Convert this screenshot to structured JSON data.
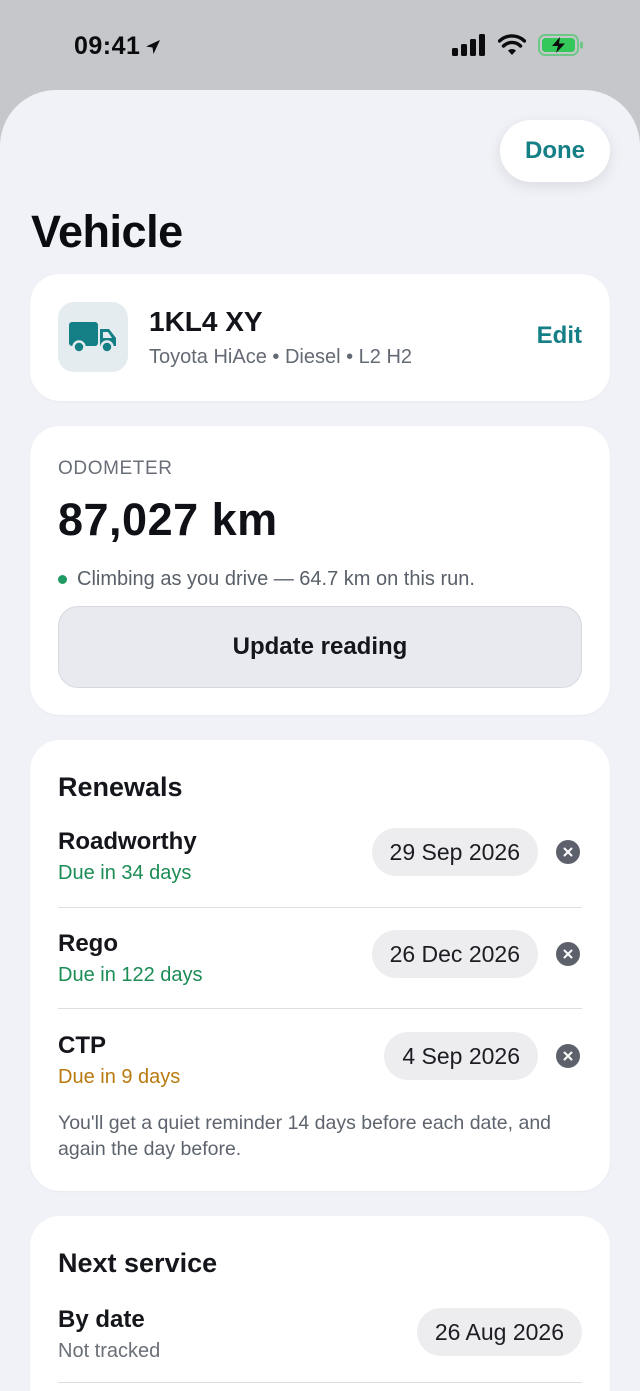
{
  "status_bar": {
    "time": "09:41",
    "icons": [
      "location-arrow-icon",
      "cellular-signal-icon",
      "wifi-icon",
      "battery-charging-icon"
    ],
    "battery_color": "#34c759"
  },
  "header": {
    "done_label": "Done",
    "title": "Vehicle"
  },
  "vehicle": {
    "icon": "truck-icon",
    "plate": "1KL4 XY",
    "description": "Toyota HiAce • Diesel • L2 H2",
    "edit_label": "Edit"
  },
  "odometer": {
    "label": "ODOMETER",
    "value": "87,027 km",
    "note": "Climbing as you drive — 64.7 km on this run.",
    "update_label": "Update reading"
  },
  "renewals": {
    "title": "Renewals",
    "items": [
      {
        "name": "Roadworthy",
        "due": "Due in 34 days",
        "date": "29 Sep 2026"
      },
      {
        "name": "Rego",
        "due": "Due in 122 days",
        "date": "26 Dec 2026"
      },
      {
        "name": "CTP",
        "due": "Due in 9 days",
        "date": "4 Sep 2026"
      }
    ],
    "footnote": "You'll get a quiet reminder 14 days before each date, and again the day before."
  },
  "next_service": {
    "title": "Next service",
    "by_date_label": "By date",
    "by_date_status": "Not tracked",
    "by_date_value": "26 Aug 2026"
  },
  "colors": {
    "accent": "#157f86",
    "due_ok": "#1c8c55",
    "due_soon": "#b97a10"
  }
}
